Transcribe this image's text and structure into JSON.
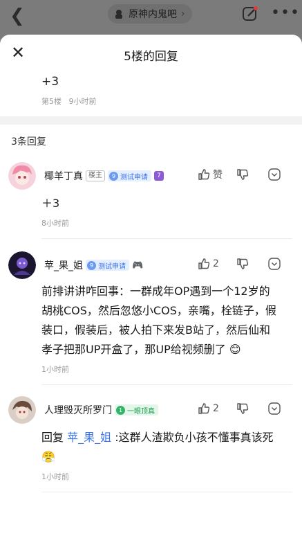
{
  "topbar": {
    "back_icon": "chevron-left-icon",
    "forum_name": "原神内鬼吧",
    "edit_icon": "edit-icon",
    "more_icon": "more-icon"
  },
  "sheet": {
    "title": "5楼的回复"
  },
  "original": {
    "text": "+3",
    "floor": "第5楼",
    "time": "9小时前"
  },
  "reply_count": "3条回复",
  "replies": [
    {
      "user": "椰羊丁真",
      "host_tag": "楼主",
      "badge_level": "9",
      "badge_text": "测试申请",
      "extra_level": "7",
      "text": "＋3",
      "time": "8小时前",
      "like_label": "赞"
    },
    {
      "user": "苹_果_姐",
      "badge_level": "9",
      "badge_text": "测试申请",
      "extra_emoji": "🎮",
      "text": "前排讲讲咋回事：一群成年OP遇到一个12岁的胡桃COS，然后忽悠小COS，亲嘴，栓链子，假装口，假装后，被人拍下来发B站了，然后仙和孝子把那UP开盒了，那UP给视频删了",
      "text_emoji": "😊",
      "time": "1小时前",
      "like_count": "2"
    },
    {
      "user": "人理毁灭所罗门",
      "badge_level": "1",
      "badge_text": "一眼顶真",
      "reply_prefix": "回复",
      "reply_to": "苹_果_姐",
      "text": ":这群人渣欺负小孩不懂事真该死",
      "text_emoji": "😤",
      "time": "1小时前",
      "like_count": "2"
    }
  ],
  "colors": {
    "accent": "#3b74e8",
    "green_badge": "#1e9e52",
    "muted": "#9a9a9a"
  }
}
